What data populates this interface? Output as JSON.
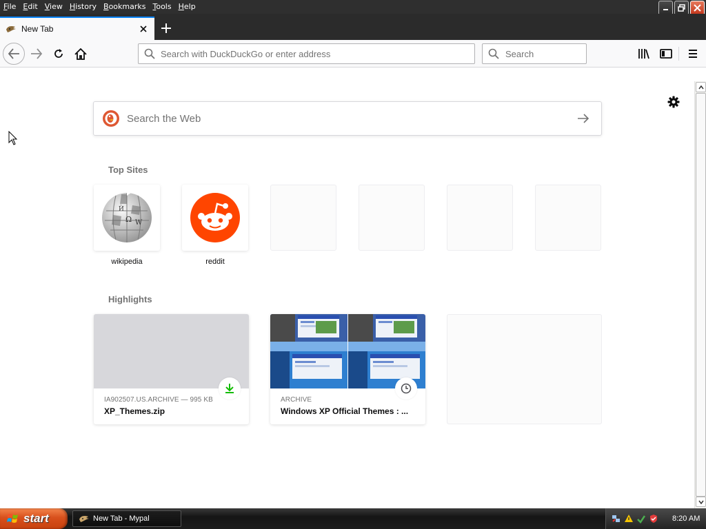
{
  "menubar": {
    "items": [
      "File",
      "Edit",
      "View",
      "History",
      "Bookmarks",
      "Tools",
      "Help"
    ]
  },
  "tab": {
    "title": "New Tab"
  },
  "navbar": {
    "url_placeholder": "Search with DuckDuckGo or enter address",
    "search_placeholder": "Search"
  },
  "content": {
    "websearch_placeholder": "Search the Web",
    "top_sites_title": "Top Sites",
    "top_sites": [
      {
        "label": "wikipedia",
        "icon": "wikipedia-globe-icon"
      },
      {
        "label": "reddit",
        "icon": "reddit-alien-icon"
      },
      {
        "label": ""
      },
      {
        "label": ""
      },
      {
        "label": ""
      },
      {
        "label": ""
      }
    ],
    "highlights_title": "Highlights",
    "highlights": [
      {
        "source": "IA902507.US.ARCHIVE — 995 KB",
        "title": "XP_Themes.zip",
        "badge_icon": "download-icon"
      },
      {
        "source": "ARCHIVE",
        "title": "Windows XP Official Themes : ...",
        "badge_icon": "clock-icon"
      }
    ]
  },
  "taskbar": {
    "start_label": "start",
    "task_label": "New Tab - Mypal",
    "clock": "8:20 AM"
  },
  "colors": {
    "accent": "#0a84ff",
    "reddit": "#ff4500",
    "download_green": "#12bc00",
    "xp_start": "#d8501c"
  }
}
